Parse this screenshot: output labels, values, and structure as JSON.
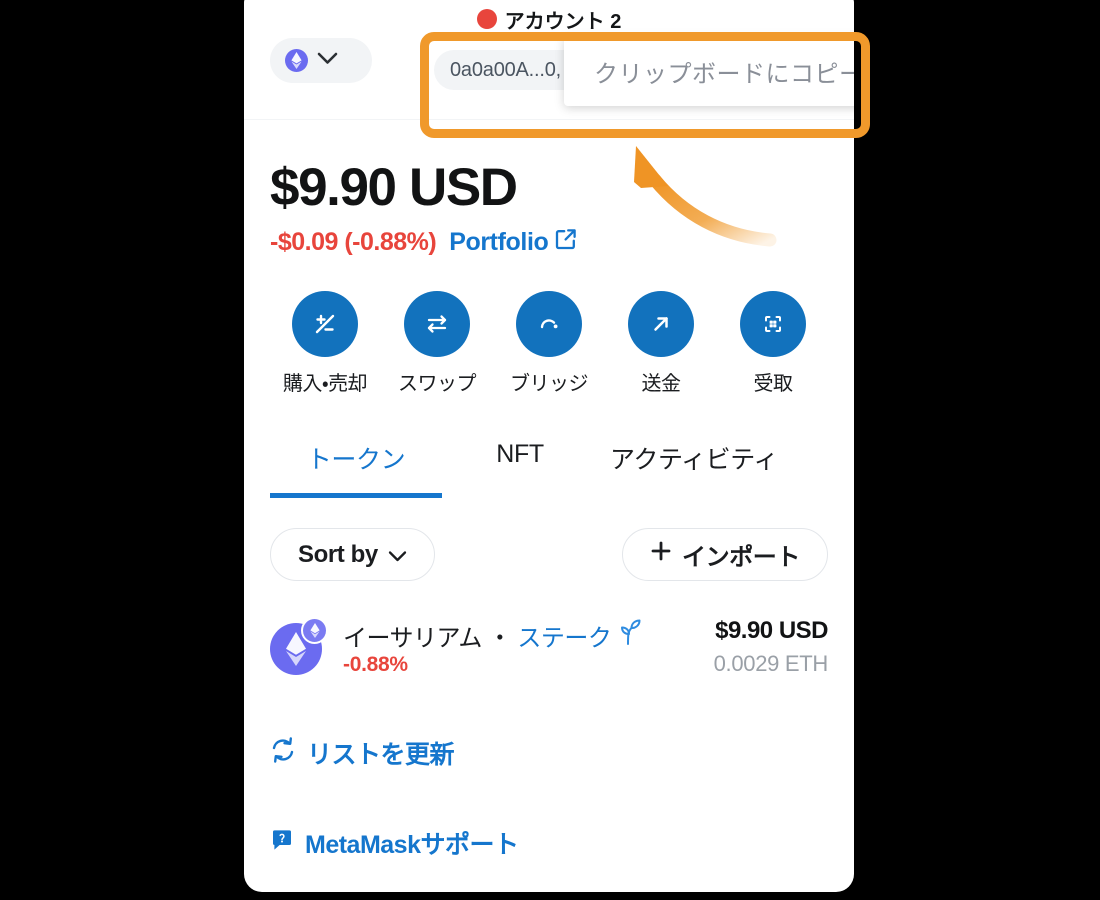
{
  "window": {
    "background_color": "#000000",
    "card_background": "#ffffff"
  },
  "header": {
    "network_selector": {
      "name": "network-selector",
      "avatar_icon": "ethereum-network-icon",
      "chevron_icon": "chevron-down-icon"
    },
    "account_name": "アカウント 2",
    "account_avatar_icon": "account-avatar-icon",
    "address": {
      "display": "0a0a00A...0,",
      "copy_icon": "copy-icon"
    },
    "copy_tooltip": {
      "text": "クリップボードにコピー"
    }
  },
  "balance": {
    "amount": "$9.90 USD",
    "change": "-$0.09 (-0.88%)",
    "change_color": "#e8453c",
    "portfolio_label": "Portfolio",
    "portfolio_color": "#1576cd",
    "portfolio_icon": "external-link-icon"
  },
  "actions": [
    {
      "label": "購入・売却",
      "icon": "buy-sell-icon"
    },
    {
      "label": "スワップ",
      "icon": "swap-icon"
    },
    {
      "label": "ブリッジ",
      "icon": "bridge-icon"
    },
    {
      "label": "送金",
      "icon": "send-arrow-icon"
    },
    {
      "label": "受取",
      "icon": "receive-qr-icon"
    }
  ],
  "tabs": [
    {
      "label": "トークン",
      "active": true
    },
    {
      "label": "NFT",
      "active": false
    },
    {
      "label": "アクティビティ",
      "active": false
    }
  ],
  "filters": {
    "sort_label": "Sort by",
    "sort_chevron_icon": "chevron-down-icon",
    "import_label": "インポート",
    "import_plus_icon": "plus-icon"
  },
  "tokens": [
    {
      "name": "イーサリアム",
      "separator": "・",
      "stake_label": "ステーク",
      "stake_icon": "sprout-icon",
      "main_icon": "ethereum-token-icon",
      "badge_icon": "ethereum-network-badge-icon",
      "change": "-0.88%",
      "change_color": "#e8453c",
      "fiat_value": "$9.90 USD",
      "quantity": "0.0029 ETH"
    }
  ],
  "footer_links": [
    {
      "label": "リストを更新",
      "icon": "refresh-icon"
    },
    {
      "label": "MetaMaskサポート",
      "icon": "support-chat-icon"
    }
  ],
  "annotation": {
    "highlight_color": "#f0992b",
    "arrow_icon": "curved-arrow-icon"
  }
}
